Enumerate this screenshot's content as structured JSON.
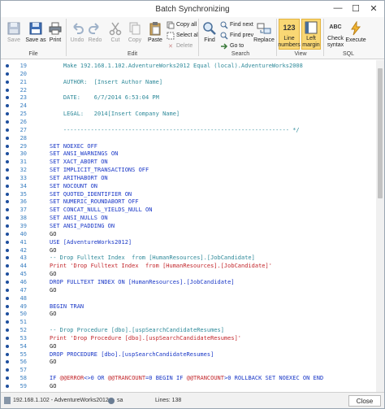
{
  "window": {
    "title": "Batch Synchronizing"
  },
  "ribbon": {
    "groups": {
      "file": "File",
      "edit": "Edit",
      "search": "Search",
      "view": "View",
      "sql": "SQL"
    },
    "save": "Save",
    "save_as": "Save as",
    "print": "Print",
    "undo": "Undo",
    "redo": "Redo",
    "cut": "Cut",
    "copy": "Copy",
    "paste": "Paste",
    "copy_all": "Copy all",
    "select_all": "Select all",
    "delete": "Delete",
    "find": "Find",
    "find_next": "Find next",
    "find_prev": "Find prev",
    "go_to": "Go to",
    "replace": "Replace",
    "line_numbers_icon_text": "123",
    "line_numbers": "Line numbers",
    "left_margin": "Left margin",
    "check_syntax_icon_text": "ABC",
    "check_syntax": "Check syntax",
    "execute": "Execute"
  },
  "editor": {
    "lines": [
      {
        "n": "19",
        "text": "    Make 192.168.1.102.AdventureWorks2012 Equal (local).AdventureWorks2008",
        "cls": "cmt",
        "bp": true
      },
      {
        "n": "20",
        "text": "",
        "cls": "cmt",
        "bp": true
      },
      {
        "n": "21",
        "text": "    AUTHOR:  [Insert Author Name]",
        "cls": "cmt",
        "bp": true
      },
      {
        "n": "22",
        "text": "",
        "cls": "cmt",
        "bp": true
      },
      {
        "n": "23",
        "text": "    DATE:    6/7/2014 6:53:04 PM",
        "cls": "cmt",
        "bp": true
      },
      {
        "n": "24",
        "text": "",
        "cls": "cmt",
        "bp": true
      },
      {
        "n": "25",
        "text": "    LEGAL:   2014[Insert Company Name]",
        "cls": "cmt",
        "bp": true
      },
      {
        "n": "26",
        "text": "",
        "cls": "cmt",
        "bp": true
      },
      {
        "n": "27",
        "text": "    ------------------------------------------------------------------ */",
        "cls": "cmt",
        "bp": true
      },
      {
        "n": "28",
        "text": "",
        "cls": "plain",
        "bp": true
      },
      {
        "n": "29",
        "text": "SET NOEXEC OFF",
        "cls": "kw",
        "bp": true
      },
      {
        "n": "30",
        "text": "SET ANSI_WARNINGS ON",
        "cls": "kw",
        "bp": true
      },
      {
        "n": "31",
        "text": "SET XACT_ABORT ON",
        "cls": "kw",
        "bp": true
      },
      {
        "n": "32",
        "text": "SET IMPLICIT_TRANSACTIONS OFF",
        "cls": "kw",
        "bp": true
      },
      {
        "n": "33",
        "text": "SET ARITHABORT ON",
        "cls": "kw",
        "bp": true
      },
      {
        "n": "34",
        "text": "SET NOCOUNT ON",
        "cls": "kw",
        "bp": true
      },
      {
        "n": "35",
        "text": "SET QUOTED_IDENTIFIER ON",
        "cls": "kw",
        "bp": true
      },
      {
        "n": "36",
        "text": "SET NUMERIC_ROUNDABORT OFF",
        "cls": "kw",
        "bp": true
      },
      {
        "n": "37",
        "text": "SET CONCAT_NULL_YIELDS_NULL ON",
        "cls": "kw",
        "bp": true
      },
      {
        "n": "38",
        "text": "SET ANSI_NULLS ON",
        "cls": "kw",
        "bp": true
      },
      {
        "n": "39",
        "text": "SET ANSI_PADDING ON",
        "cls": "kw",
        "bp": true
      },
      {
        "n": "40",
        "text": "GO",
        "cls": "plain",
        "bp": true
      },
      {
        "n": "41",
        "text": "USE [AdventureWorks2012]",
        "cls": "kw",
        "bp": true
      },
      {
        "n": "42",
        "text": "GO",
        "cls": "plain",
        "bp": true
      },
      {
        "n": "43",
        "text": "-- Drop Fulltext Index  from [HumanResources].[JobCandidate]",
        "cls": "cmt",
        "bp": true
      },
      {
        "n": "44",
        "text": "Print 'Drop Fulltext Index  from [HumanResources].[JobCandidate]'",
        "cls": "str",
        "bp": true
      },
      {
        "n": "45",
        "text": "GO",
        "cls": "plain",
        "bp": true
      },
      {
        "n": "46",
        "text": "DROP FULLTEXT INDEX ON [HumanResources].[JobCandidate]",
        "cls": "kw",
        "bp": true
      },
      {
        "n": "47",
        "text": "GO",
        "cls": "plain",
        "bp": true
      },
      {
        "n": "48",
        "text": "",
        "cls": "plain",
        "bp": true
      },
      {
        "n": "49",
        "text": "BEGIN TRAN",
        "cls": "kw",
        "bp": true
      },
      {
        "n": "50",
        "text": "GO",
        "cls": "plain",
        "bp": true
      },
      {
        "n": "51",
        "text": "",
        "cls": "plain",
        "bp": true
      },
      {
        "n": "52",
        "text": "-- Drop Procedure [dbo].[uspSearchCandidateResumes]",
        "cls": "cmt",
        "bp": true
      },
      {
        "n": "53",
        "text": "Print 'Drop Procedure [dbo].[uspSearchCandidateResumes]'",
        "cls": "str",
        "bp": true
      },
      {
        "n": "54",
        "text": "GO",
        "cls": "plain",
        "bp": true
      },
      {
        "n": "55",
        "text": "DROP PROCEDURE [dbo].[uspSearchCandidateResumes]",
        "cls": "kw",
        "bp": true
      },
      {
        "n": "56",
        "text": "GO",
        "cls": "plain",
        "bp": true
      },
      {
        "n": "57",
        "text": "",
        "cls": "plain",
        "bp": true
      },
      {
        "n": "58",
        "text": "IF @@ERROR<>0 OR @@TRANCOUNT=0 BEGIN IF @@TRANCOUNT>0 ROLLBACK SET NOEXEC ON END",
        "cls": "kw",
        "bp": true
      },
      {
        "n": "59",
        "text": "GO",
        "cls": "plain",
        "bp": true
      }
    ]
  },
  "status": {
    "server": "192.168.1.102 - AdventureWorks2012",
    "user": "sa",
    "lines": "Lines: 138",
    "close": "Close"
  },
  "colors": {
    "keyword": "#1a38c7",
    "string": "#c2262b",
    "comment": "#2f8a9a",
    "line_number": "#3a7fc1",
    "active_toggle": "#f9d774"
  }
}
